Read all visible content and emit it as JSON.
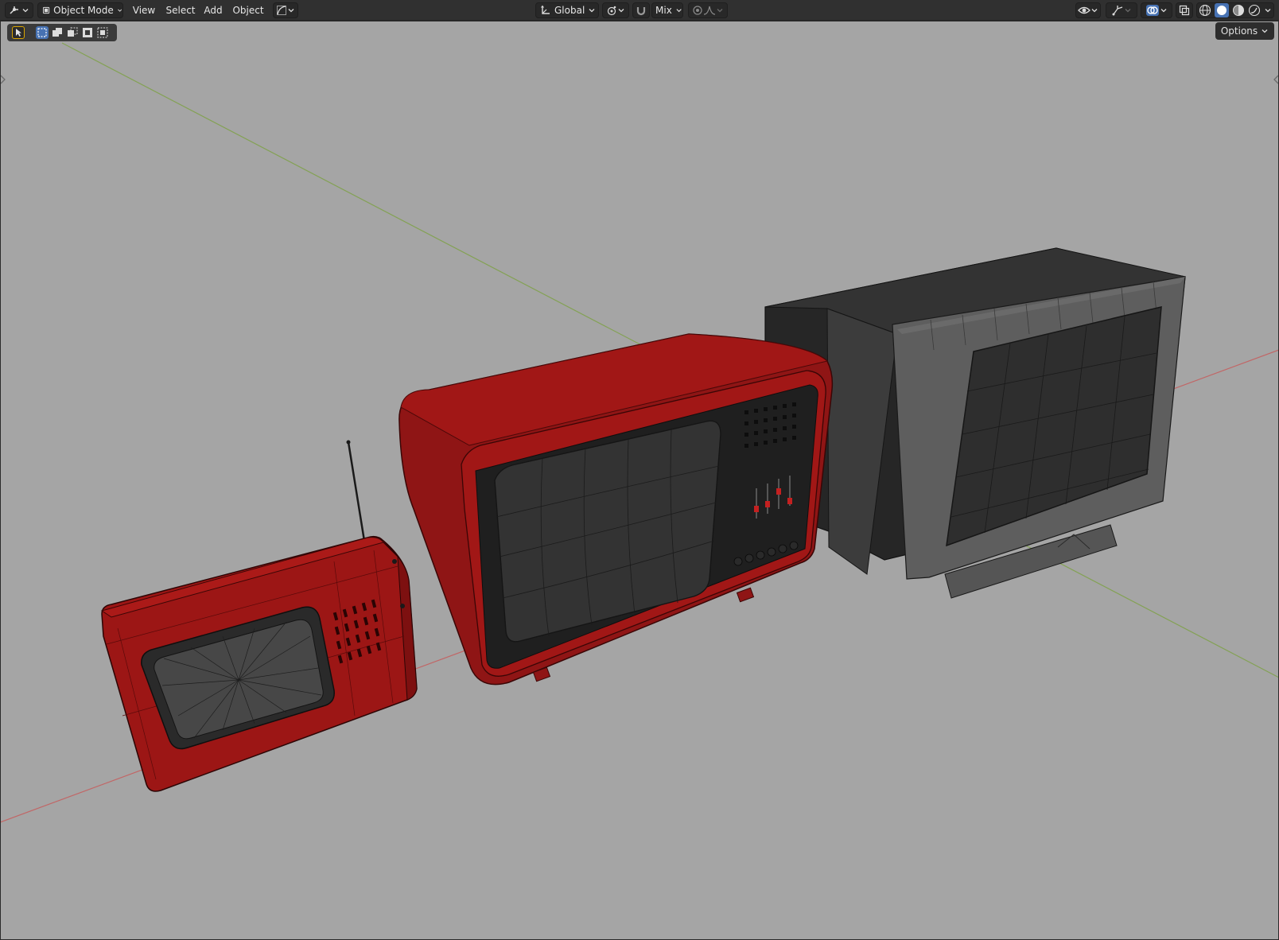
{
  "header": {
    "mode_label": "Object Mode",
    "menus": [
      "View",
      "Select",
      "Add",
      "Object"
    ],
    "orientation_label": "Global",
    "snap_mode_label": "Mix"
  },
  "toolbar": {
    "options_label": "Options"
  },
  "icons": {
    "editor_type": "editor-type-icon",
    "object_mode": "object-mode-icon",
    "transform_orientation": "transform-axes-icon",
    "pivot": "pivot-point-icon",
    "snap": "magnet-icon",
    "proportional_edit": "proportional-edit-icon",
    "falloff": "falloff-curve-icon",
    "visibility": "eye-icon",
    "gizmo": "gizmo-icon",
    "overlays": "overlays-icon",
    "xray": "xray-icon",
    "shading_wire": "wireframe-shading-icon",
    "shading_solid": "solid-shading-icon",
    "shading_material": "material-shading-icon",
    "shading_rendered": "rendered-shading-icon"
  },
  "colors": {
    "viewport_bg": "#a5a5a5",
    "header_bg": "#303030",
    "accent_blue": "#4772b3",
    "x_axis": "#c65c5c",
    "y_axis": "#7ea147",
    "tv_red": "#a11716",
    "tv_dark": "#2a2a2a"
  },
  "scene": {
    "objects": [
      "small-red-tv",
      "red-crt-tv",
      "black-crt-monitor"
    ]
  }
}
